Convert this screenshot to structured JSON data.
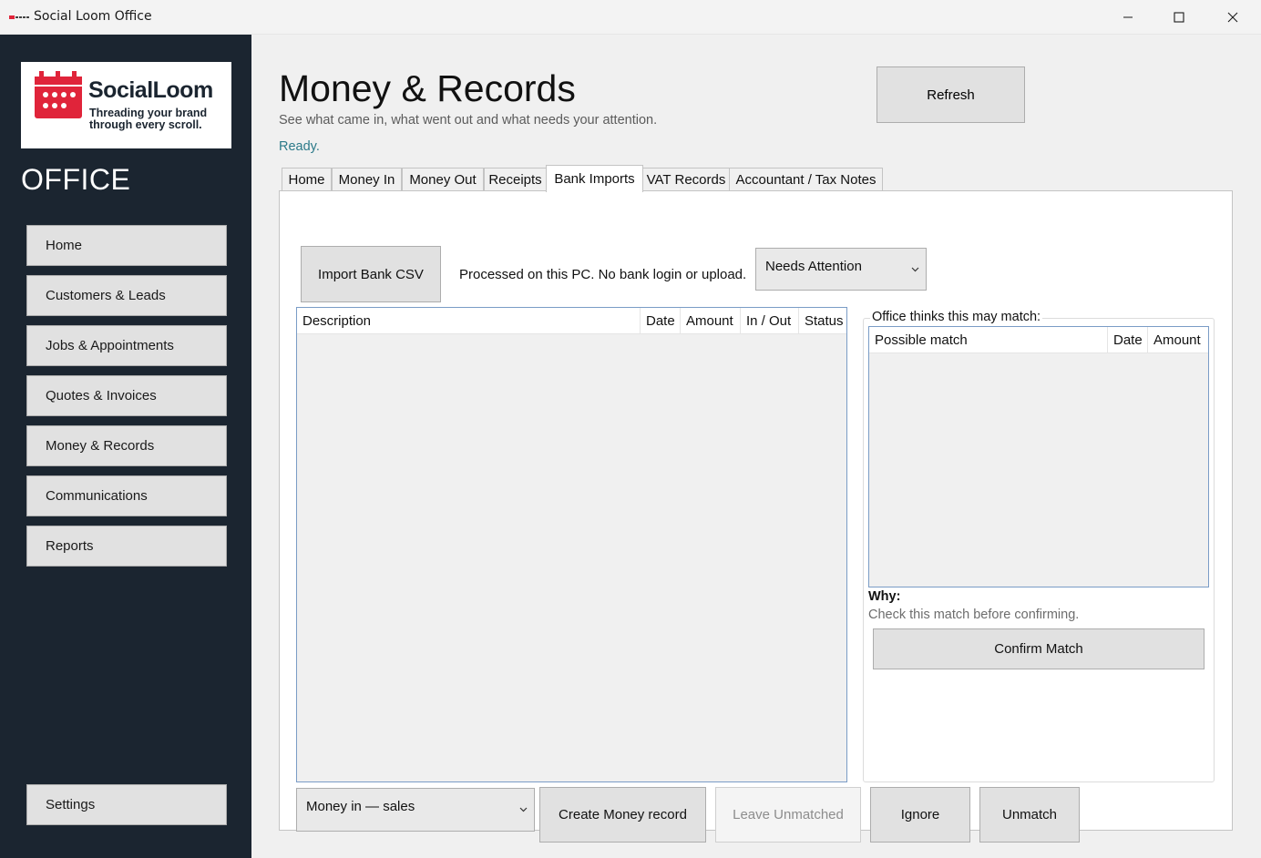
{
  "window": {
    "title": "Social Loom Office",
    "controls": [
      "minimize",
      "maximize",
      "close"
    ]
  },
  "sidebar": {
    "logo": {
      "name": "SocialLoom",
      "tagline_1": "Threading your brand",
      "tagline_2": "through every scroll."
    },
    "section_label": "OFFICE",
    "items": [
      {
        "label": "Home"
      },
      {
        "label": "Customers & Leads"
      },
      {
        "label": "Jobs & Appointments"
      },
      {
        "label": "Quotes & Invoices"
      },
      {
        "label": "Money & Records"
      },
      {
        "label": "Communications"
      },
      {
        "label": "Reports"
      }
    ],
    "settings_label": "Settings"
  },
  "header": {
    "title": "Money & Records",
    "subtitle": "See what came in, what went out and what needs your attention.",
    "status": "Ready.",
    "refresh_label": "Refresh"
  },
  "tabs": [
    {
      "label": "Home"
    },
    {
      "label": "Money In"
    },
    {
      "label": "Money Out"
    },
    {
      "label": "Receipts"
    },
    {
      "label": "Bank Imports",
      "active": true
    },
    {
      "label": "VAT Records"
    },
    {
      "label": "Accountant / Tax Notes"
    }
  ],
  "bank_imports": {
    "import_button": "Import Bank CSV",
    "privacy_note": "Processed on this PC. No bank login or upload.",
    "filter_selected": "Needs Attention",
    "transactions_columns": [
      "Description",
      "Date",
      "Amount",
      "In / Out",
      "Status"
    ],
    "transactions_rows": [],
    "match_group_label": "Office thinks this may match:",
    "match_columns": [
      "Possible match",
      "Date",
      "Amount"
    ],
    "match_rows": [],
    "why_label": "Why:",
    "why_text": "Check this match before confirming.",
    "confirm_button": "Confirm Match",
    "record_type_selected": "Money in — sales",
    "create_button": "Create Money record",
    "leave_button": "Leave Unmatched",
    "ignore_button": "Ignore",
    "unmatch_button": "Unmatch"
  },
  "colors": {
    "sidebar_bg": "#1b2530",
    "brand_red": "#e0243a",
    "status_teal": "#2c7a89",
    "button_bg": "#e1e1e1",
    "list_border": "#7a9cc6"
  }
}
